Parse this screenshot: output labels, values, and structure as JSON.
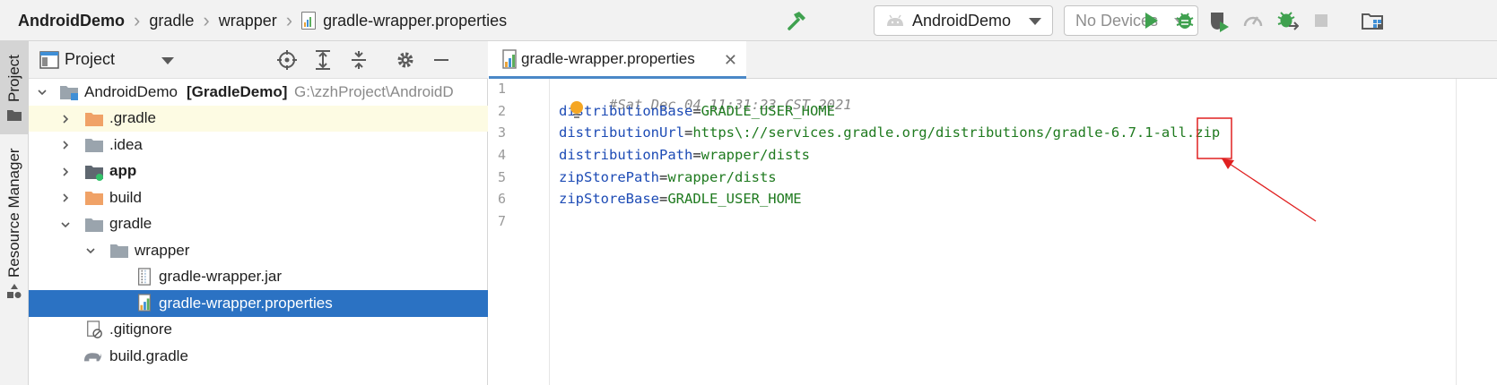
{
  "breadcrumb": {
    "project": "AndroidDemo",
    "folder1": "gradle",
    "folder2": "wrapper",
    "file": "gradle-wrapper.properties"
  },
  "toolbar": {
    "run_config": "AndroidDemo",
    "device": "No Devices",
    "icons": [
      "hammer-icon",
      "run-icon",
      "debug-icon",
      "profile-icon",
      "profiler-icon",
      "attach-debugger-icon",
      "stop-icon",
      "project-structure-icon"
    ]
  },
  "side_stripe": {
    "project_tab": "Project",
    "resource_manager_tab": "Resource Manager"
  },
  "project_panel": {
    "title": "Project",
    "icons": [
      "locate-icon",
      "expand-all-icon",
      "collapse-all-icon",
      "settings-icon",
      "hide-icon"
    ],
    "tree": [
      {
        "label": "AndroidDemo",
        "module": "[GradleDemo]",
        "path": "G:\\zzhProject\\AndroidD",
        "icon": "module-folder-icon"
      },
      {
        "label": ".gradle",
        "icon": "folder-orange-icon"
      },
      {
        "label": ".idea",
        "icon": "folder-icon"
      },
      {
        "label": "app",
        "icon": "app-module-icon"
      },
      {
        "label": "build",
        "icon": "folder-orange-icon"
      },
      {
        "label": "gradle",
        "icon": "folder-icon"
      },
      {
        "label": "wrapper",
        "icon": "folder-icon"
      },
      {
        "label": "gradle-wrapper.jar",
        "icon": "jar-file-icon"
      },
      {
        "label": "gradle-wrapper.properties",
        "icon": "properties-file-icon"
      },
      {
        "label": ".gitignore",
        "icon": "gitignore-file-icon"
      },
      {
        "label": "build.gradle",
        "icon": "gradle-file-icon"
      }
    ]
  },
  "editor": {
    "tab_label": "gradle-wrapper.properties",
    "line_numbers": [
      "1",
      "2",
      "3",
      "4",
      "5",
      "6",
      "7"
    ],
    "lines": [
      {
        "comment": "#Sat Dec 04 11:31:23 CST 2021"
      },
      {
        "key": "distributionBase",
        "eq": "=",
        "value": "GRADLE_USER_HOME"
      },
      {
        "key": "distributionUrl",
        "eq": "=",
        "value": "https\\://services.gradle.org/distributions/gradle-6.7.1-all.zip"
      },
      {
        "key": "distributionPath",
        "eq": "=",
        "value": "wrapper/dists"
      },
      {
        "key": "zipStorePath",
        "eq": "=",
        "value": "wrapper/dists"
      },
      {
        "key": "zipStoreBase",
        "eq": "=",
        "value": "GRADLE_USER_HOME"
      }
    ]
  },
  "colors": {
    "selection": "#2b72c3",
    "highlight_row": "#fdfbe3",
    "annotation_red": "#e02020",
    "run_green": "#3fa14f",
    "folder_orange": "#f0a267"
  }
}
